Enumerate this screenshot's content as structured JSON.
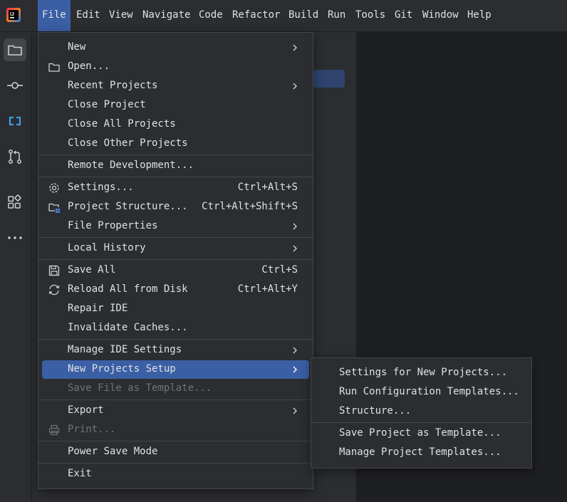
{
  "menubar": {
    "items": [
      "File",
      "Edit",
      "View",
      "Navigate",
      "Code",
      "Refactor",
      "Build",
      "Run",
      "Tools",
      "Git",
      "Window",
      "Help"
    ],
    "active_index": 0
  },
  "file_menu": {
    "items": [
      {
        "label": "New",
        "shortcut": "",
        "submenu": true,
        "icon": "",
        "disabled": false
      },
      {
        "label": "Open...",
        "shortcut": "",
        "submenu": false,
        "icon": "folder-icon",
        "disabled": false
      },
      {
        "label": "Recent Projects",
        "shortcut": "",
        "submenu": true,
        "icon": "",
        "disabled": false
      },
      {
        "label": "Close Project",
        "shortcut": "",
        "submenu": false,
        "icon": "",
        "disabled": false
      },
      {
        "label": "Close All Projects",
        "shortcut": "",
        "submenu": false,
        "icon": "",
        "disabled": false
      },
      {
        "label": "Close Other Projects",
        "shortcut": "",
        "submenu": false,
        "icon": "",
        "disabled": false
      },
      {
        "label": "Remote Development...",
        "shortcut": "",
        "submenu": false,
        "icon": "",
        "disabled": false
      },
      {
        "label": "Settings...",
        "shortcut": "Ctrl+Alt+S",
        "submenu": false,
        "icon": "gear-icon",
        "disabled": false
      },
      {
        "label": "Project Structure...",
        "shortcut": "Ctrl+Alt+Shift+S",
        "submenu": false,
        "icon": "project-structure-icon",
        "disabled": false
      },
      {
        "label": "File Properties",
        "shortcut": "",
        "submenu": true,
        "icon": "",
        "disabled": false
      },
      {
        "label": "Local History",
        "shortcut": "",
        "submenu": true,
        "icon": "",
        "disabled": false
      },
      {
        "label": "Save All",
        "shortcut": "Ctrl+S",
        "submenu": false,
        "icon": "save-icon",
        "disabled": false
      },
      {
        "label": "Reload All from Disk",
        "shortcut": "Ctrl+Alt+Y",
        "submenu": false,
        "icon": "reload-icon",
        "disabled": false
      },
      {
        "label": "Repair IDE",
        "shortcut": "",
        "submenu": false,
        "icon": "",
        "disabled": false
      },
      {
        "label": "Invalidate Caches...",
        "shortcut": "",
        "submenu": false,
        "icon": "",
        "disabled": false
      },
      {
        "label": "Manage IDE Settings",
        "shortcut": "",
        "submenu": true,
        "icon": "",
        "disabled": false
      },
      {
        "label": "New Projects Setup",
        "shortcut": "",
        "submenu": true,
        "icon": "",
        "disabled": false,
        "highlighted": true
      },
      {
        "label": "Save File as Template...",
        "shortcut": "",
        "submenu": false,
        "icon": "",
        "disabled": true
      },
      {
        "label": "Export",
        "shortcut": "",
        "submenu": true,
        "icon": "",
        "disabled": false
      },
      {
        "label": "Print...",
        "shortcut": "",
        "submenu": false,
        "icon": "print-icon",
        "disabled": true
      },
      {
        "label": "Power Save Mode",
        "shortcut": "",
        "submenu": false,
        "icon": "",
        "disabled": false
      },
      {
        "label": "Exit",
        "shortcut": "",
        "submenu": false,
        "icon": "",
        "disabled": false
      }
    ]
  },
  "submenu": {
    "items": [
      {
        "label": "Settings for New Projects..."
      },
      {
        "label": "Run Configuration Templates..."
      },
      {
        "label": "Structure..."
      },
      {
        "label": "Save Project as Template..."
      },
      {
        "label": "Manage Project Templates..."
      }
    ]
  },
  "toolstrip": {
    "icons": [
      "project-folder-icon",
      "commit-icon",
      "code-with-me-icon",
      "pull-requests-icon",
      "structure-icon",
      "more-tools-icon"
    ]
  },
  "colors": {
    "accent": "#3b5fa5",
    "background": "#2b2d30",
    "editor": "#1e1f22",
    "text": "#dfe1e5",
    "disabled_text": "#6f737a"
  }
}
